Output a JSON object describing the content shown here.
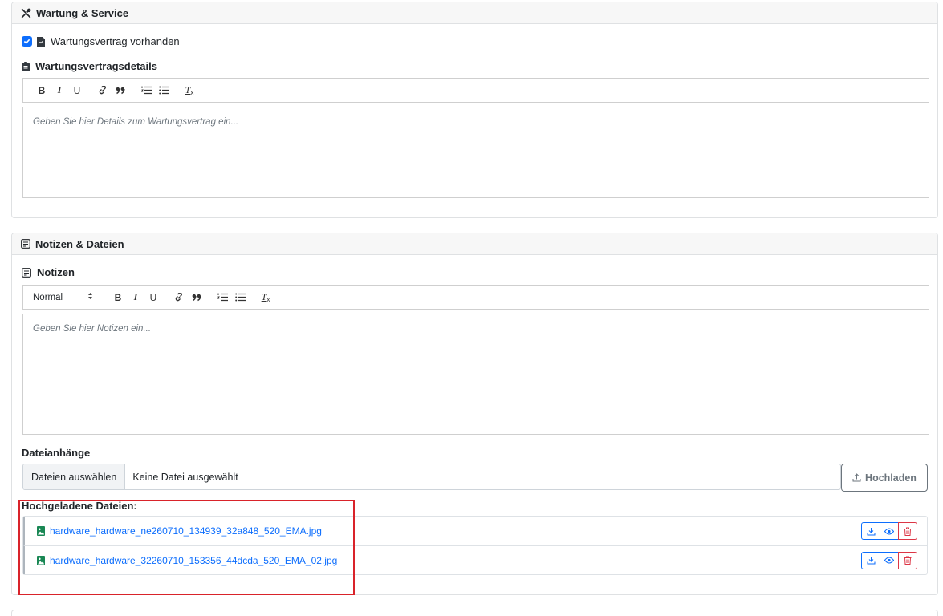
{
  "maintenance": {
    "title": "Wartung & Service",
    "contract_checkbox_label": "Wartungsvertrag vorhanden",
    "contract_checked": true,
    "details_label": "Wartungsvertragsdetails",
    "details_placeholder": "Geben Sie hier Details zum Wartungsvertrag ein..."
  },
  "notes": {
    "title": "Notizen & Dateien",
    "notes_label": "Notizen",
    "format_select": "Normal",
    "notes_placeholder": "Geben Sie hier Notizen ein...",
    "attachments_label": "Dateianhänge",
    "choose_files_button": "Dateien auswählen",
    "no_file_text": "Keine Datei ausgewählt",
    "upload_button": "Hochladen",
    "uploaded_label": "Hochgeladene Dateien:",
    "files": [
      {
        "name": "hardware_hardware_ne260710_134939_32a848_520_EMA.jpg"
      },
      {
        "name": "hardware_hardware_32260710_153356_44dcda_520_EMA_02.jpg"
      }
    ]
  },
  "toolbar": {
    "bold": "B",
    "italic": "I",
    "underline": "U",
    "clear": "T"
  },
  "colors": {
    "accent": "#0d6efd",
    "danger": "#dc3545",
    "highlight": "#d9232a"
  }
}
